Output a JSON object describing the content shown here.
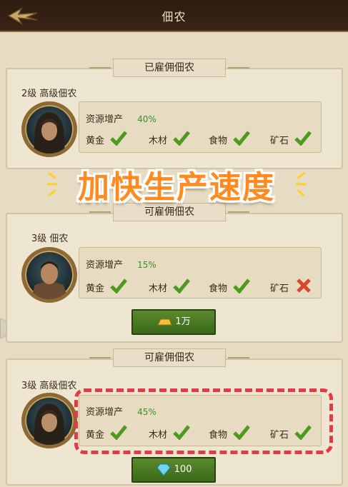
{
  "header": {
    "title": "佃农"
  },
  "overlay": {
    "banner_text": "加快生产速度"
  },
  "sections": [
    {
      "header": "已雇佣佃农",
      "level": "2级 高级佃农",
      "resource_label": "资源增产",
      "resource_pct": "40%",
      "resources": [
        {
          "name": "黄金",
          "status": "check"
        },
        {
          "name": "木材",
          "status": "check"
        },
        {
          "name": "食物",
          "status": "check"
        },
        {
          "name": "矿石",
          "status": "check"
        }
      ]
    },
    {
      "header": "可雇佣佃农",
      "level": "3级 佃农",
      "resource_label": "资源增产",
      "resource_pct": "15%",
      "resources": [
        {
          "name": "黄金",
          "status": "check"
        },
        {
          "name": "木材",
          "status": "check"
        },
        {
          "name": "食物",
          "status": "check"
        },
        {
          "name": "矿石",
          "status": "cross"
        }
      ],
      "button_label": "1万",
      "button_icon": "gold-bar-icon"
    },
    {
      "header": "可雇佣佃农",
      "level": "3级 高级佃农",
      "resource_label": "资源增产",
      "resource_pct": "45%",
      "resources": [
        {
          "name": "黄金",
          "status": "check"
        },
        {
          "name": "木材",
          "status": "check"
        },
        {
          "name": "食物",
          "status": "check"
        },
        {
          "name": "矿石",
          "status": "check"
        }
      ],
      "button_label": "100",
      "button_icon": "diamond-icon"
    }
  ]
}
